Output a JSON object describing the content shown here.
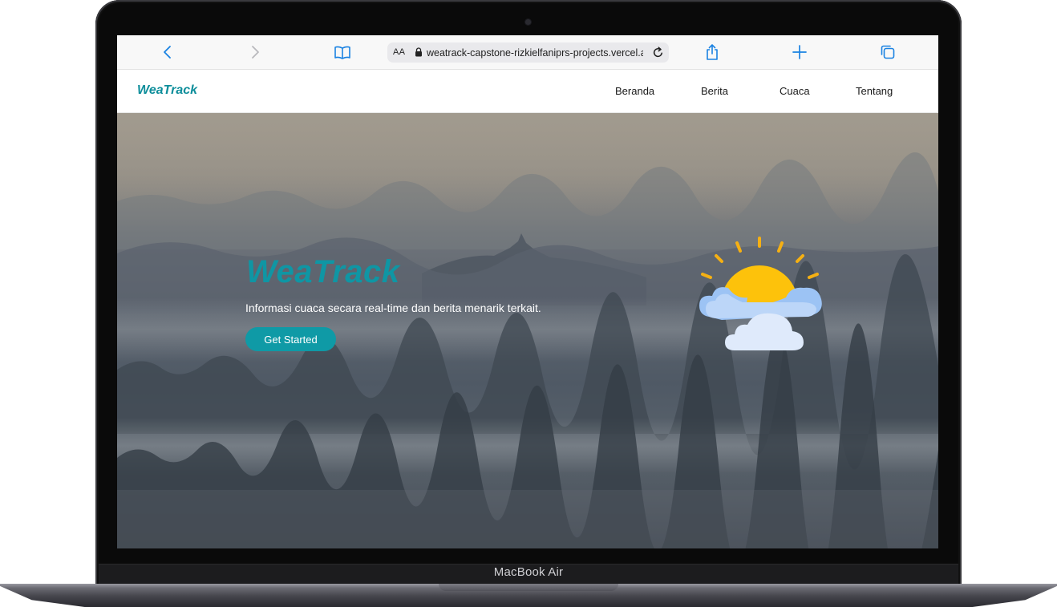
{
  "device": {
    "label": "MacBook Air"
  },
  "browser": {
    "address_text_size": "AA",
    "url": "weatrack-capstone-rizkielfaniprs-projects.vercel.app"
  },
  "site": {
    "brand": "WeaTrack",
    "nav": [
      {
        "label": "Beranda"
      },
      {
        "label": "Berita"
      },
      {
        "label": "Cuaca"
      },
      {
        "label": "Tentang"
      }
    ]
  },
  "hero": {
    "title": "WeaTrack",
    "subtitle": "Informasi cuaca secara real-time dan berita menarik terkait.",
    "cta_label": "Get Started"
  },
  "icons": {
    "back": "chevron-left-icon",
    "forward": "chevron-right-icon",
    "bookmarks": "book-icon",
    "lock": "lock-icon",
    "reload": "reload-icon",
    "share": "share-icon",
    "new_tab": "plus-icon",
    "tabs": "tabs-icon",
    "weather": "sun-behind-clouds-icon"
  },
  "colors": {
    "brand": "#0e8e9b",
    "cta": "#0f9aa6",
    "safari_blue": "#1a82e2",
    "sun": "#fdc20b",
    "sun_rays": "#f5b013",
    "cloud_back": "#9cc3f4",
    "cloud_front": "#dfeafb"
  }
}
